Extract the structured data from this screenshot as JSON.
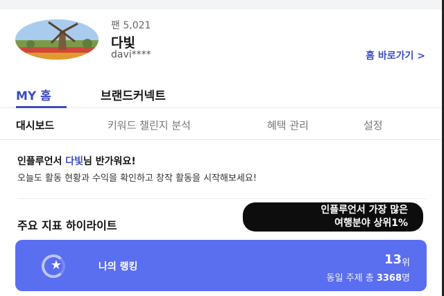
{
  "profile": {
    "fans_label": "팬 5,021",
    "name": "다빛",
    "handle": "davi****",
    "home_link": "홈 바로가기 >"
  },
  "main_tabs": [
    {
      "label": "MY 홈",
      "active": true
    },
    {
      "label": "브랜드커넥트",
      "active": false
    }
  ],
  "sub_tabs": [
    {
      "label": "대시보드",
      "active": true
    },
    {
      "label": "키워드 챌린지 분석",
      "active": false
    },
    {
      "label": "혜택 관리",
      "active": false
    },
    {
      "label": "설정",
      "active": false
    }
  ],
  "greeting": {
    "prefix": "인플루언서 ",
    "name": "다빛",
    "suffix": "님 반가워요!",
    "subtitle": "오늘도 활동 현황과 수익을 확인하고 창작 활동을 시작해보세요!"
  },
  "highlights": {
    "title": "주요 지표 하이라이트",
    "bubble_line1": "인플루언서 가장 많은",
    "bubble_line2": "여행분야 상위1%"
  },
  "ranking": {
    "label": "나의 랭킹",
    "value": "13",
    "unit": "위",
    "total_prefix": "동일 주제 총 ",
    "total_count": "3368",
    "total_suffix": "명"
  },
  "colors": {
    "accent": "#3b4cc0",
    "card": "#5a6ef0"
  }
}
